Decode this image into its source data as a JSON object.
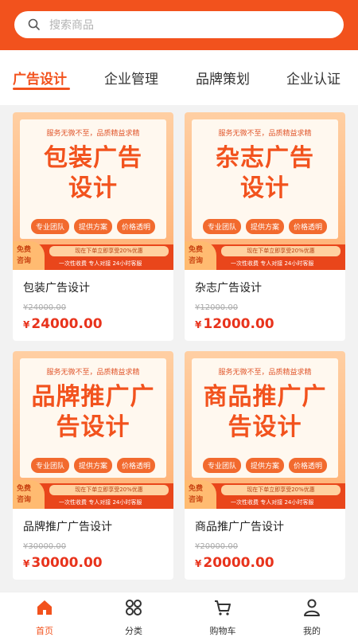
{
  "search": {
    "placeholder": "搜索商品"
  },
  "tabs": [
    {
      "label": "广告设计",
      "active": true
    },
    {
      "label": "企业管理",
      "active": false
    },
    {
      "label": "品牌策划",
      "active": false
    },
    {
      "label": "企业认证",
      "active": false
    }
  ],
  "poster_common": {
    "slogan": "服务无微不至，品质精益求精",
    "pills": [
      "专业团队",
      "提供方案",
      "价格透明"
    ],
    "promo": "现在下单立即享受20%优惠",
    "service": "一次性收费  专人对接  24小时客服",
    "consult_1": "免费",
    "consult_2": "咨询"
  },
  "products": [
    {
      "poster_line1": "包装广告",
      "poster_line2": "设计",
      "name": "包装广告设计",
      "original_price": "¥24000.00",
      "yen": "¥",
      "price": "24000.00"
    },
    {
      "poster_line1": "杂志广告",
      "poster_line2": "设计",
      "name": "杂志广告设计",
      "original_price": "¥12000.00",
      "yen": "¥",
      "price": "12000.00"
    },
    {
      "poster_line1": "品牌推广广",
      "poster_line2": "告设计",
      "name": "品牌推广广告设计",
      "original_price": "¥30000.00",
      "yen": "¥",
      "price": "30000.00"
    },
    {
      "poster_line1": "商品推广广",
      "poster_line2": "告设计",
      "name": "商品推广广告设计",
      "original_price": "¥20000.00",
      "yen": "¥",
      "price": "20000.00"
    }
  ],
  "bottom_nav": [
    {
      "label": "首页",
      "icon": "home-icon",
      "active": true
    },
    {
      "label": "分类",
      "icon": "category-icon",
      "active": false
    },
    {
      "label": "购物车",
      "icon": "cart-icon",
      "active": false
    },
    {
      "label": "我的",
      "icon": "user-icon",
      "active": false
    }
  ],
  "colors": {
    "accent": "#f2521d",
    "price": "#e8331c"
  }
}
